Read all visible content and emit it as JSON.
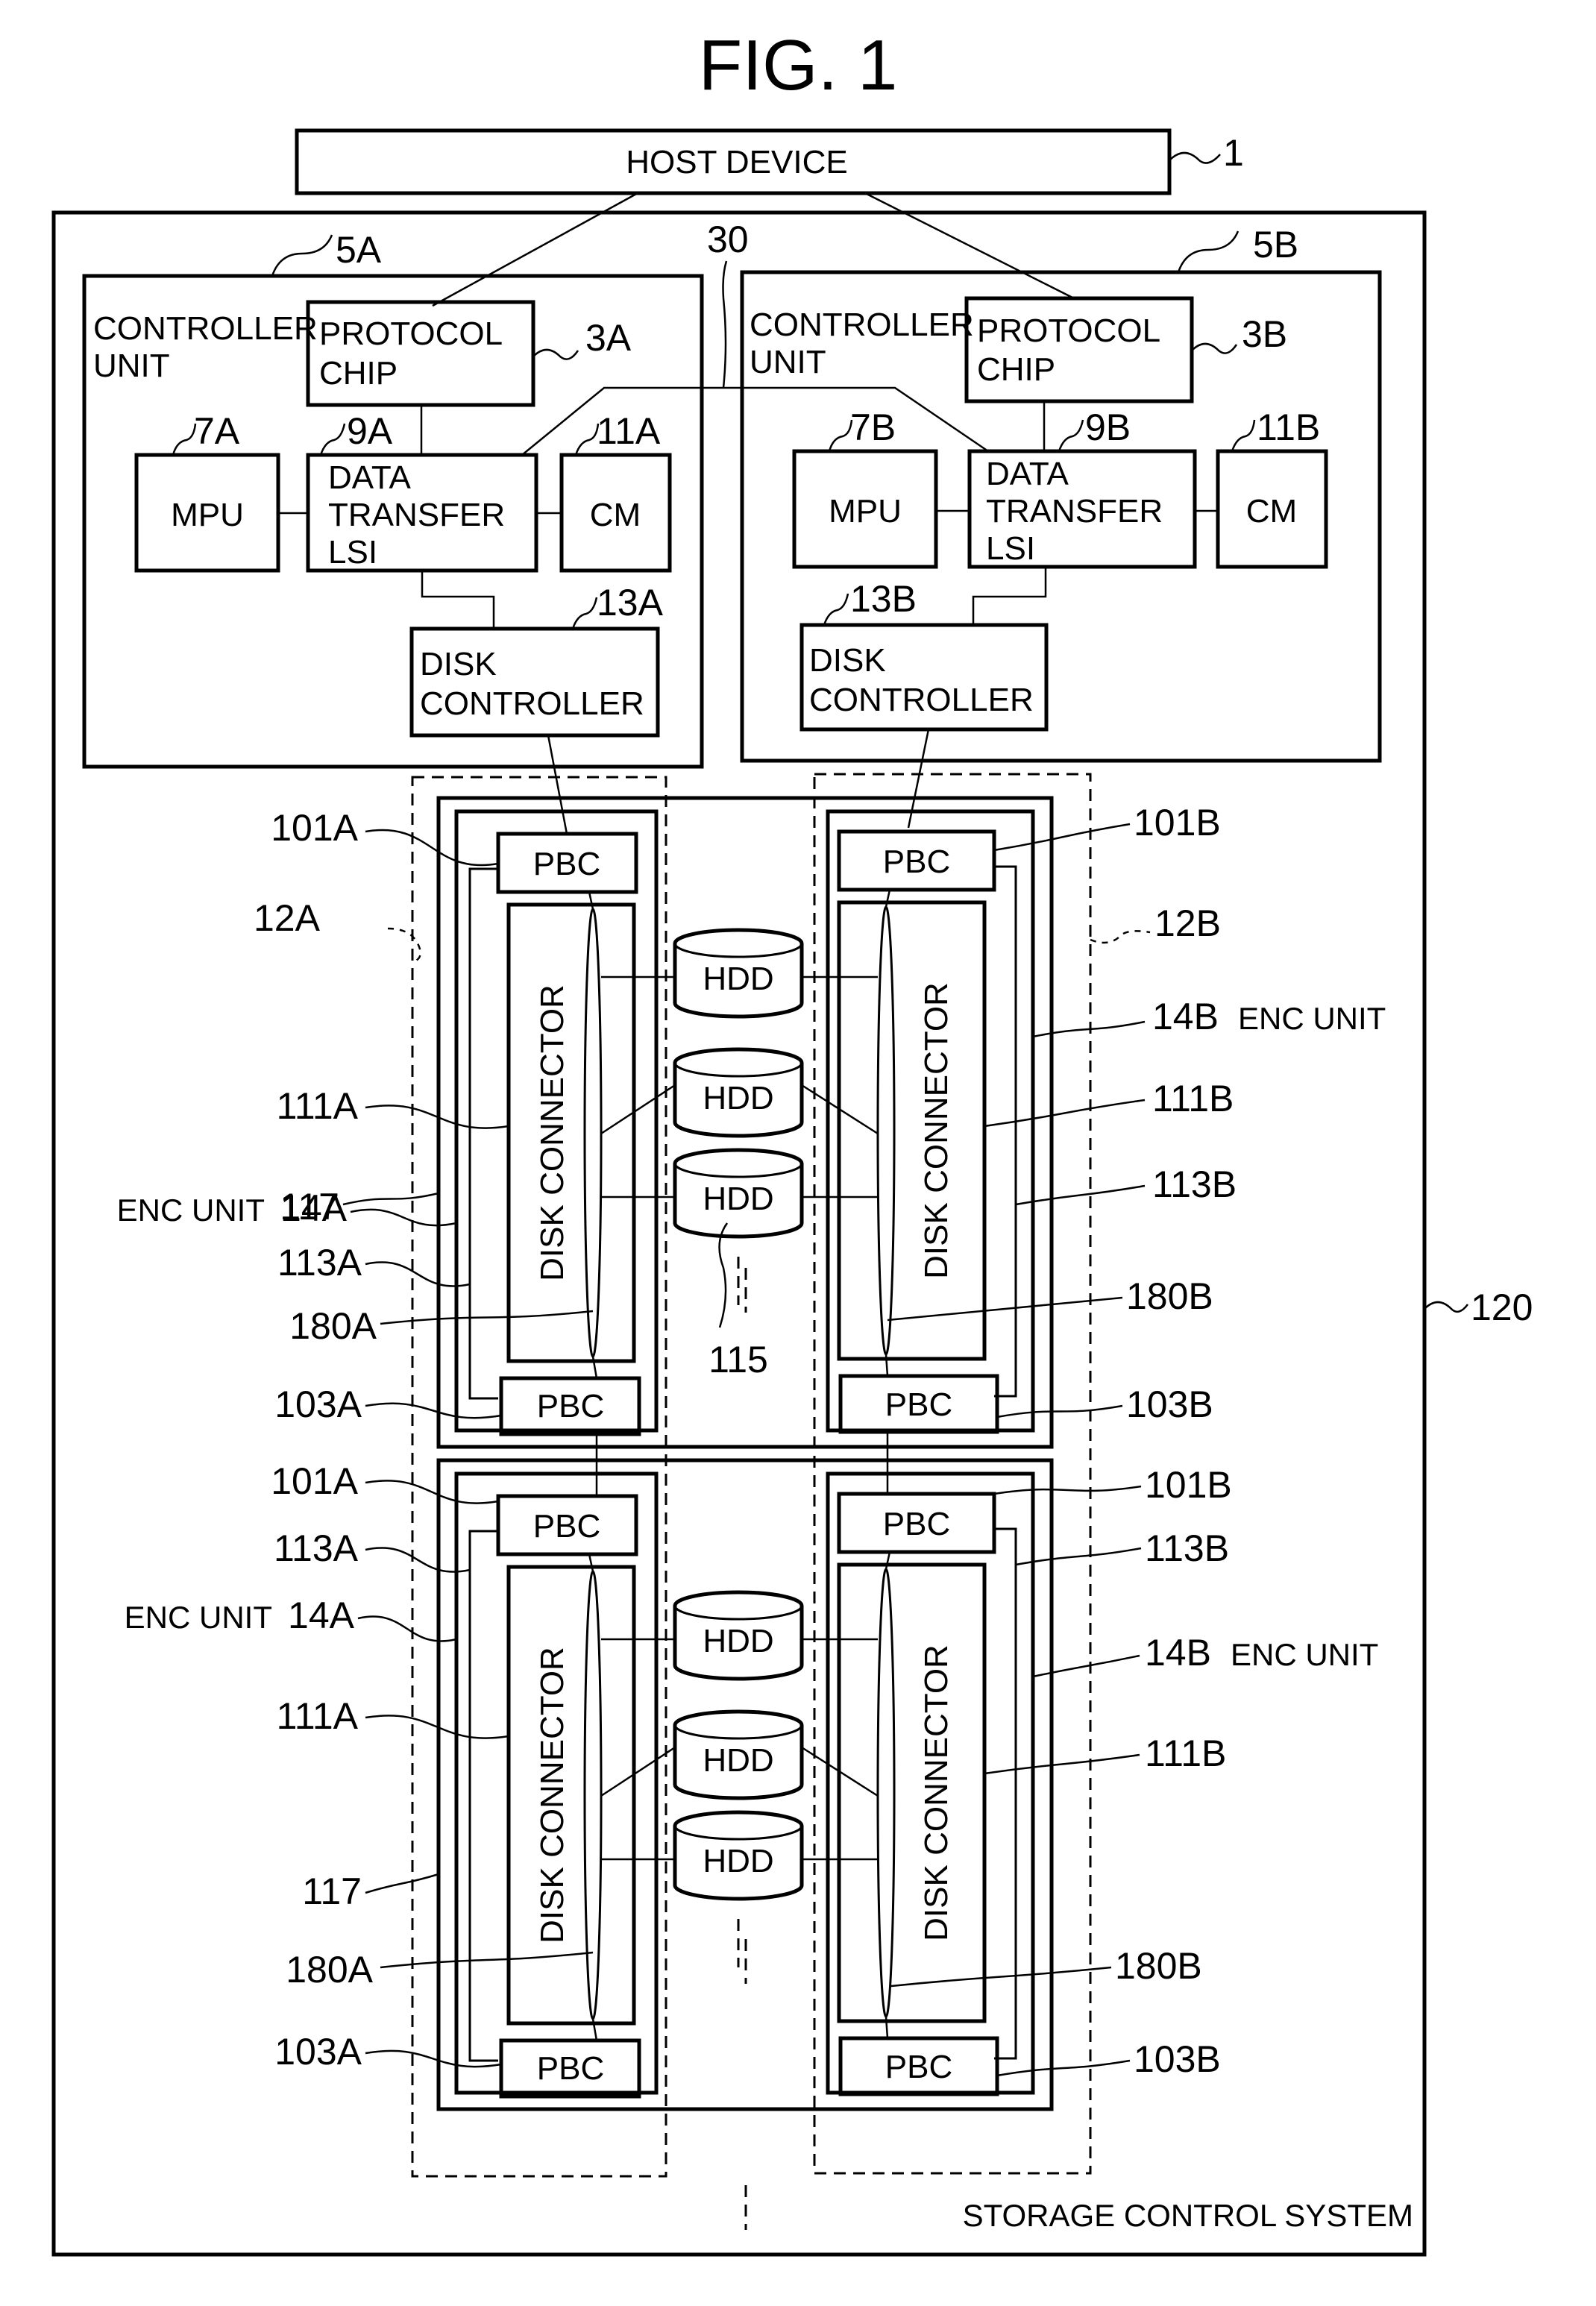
{
  "figure": {
    "title": "FIG. 1",
    "system_label": "STORAGE CONTROL SYSTEM",
    "system_ref": "120",
    "path_ref": "30",
    "host": {
      "label": "HOST DEVICE",
      "ref": "1"
    }
  },
  "controllers": [
    {
      "id": "A",
      "ref": "5A",
      "unit_label_line1": "CONTROLLER",
      "unit_label_line2": "UNIT",
      "protocol_chip": {
        "line1": "PROTOCOL",
        "line2": "CHIP",
        "ref": "3A"
      },
      "mpu": {
        "label": "MPU",
        "ref": "7A"
      },
      "data_transfer_lsi": {
        "line1": "DATA",
        "line2": "TRANSFER",
        "line3": "LSI",
        "ref": "9A"
      },
      "cm": {
        "label": "CM",
        "ref": "11A"
      },
      "disk_controller": {
        "line1": "DISK",
        "line2": "CONTROLLER",
        "ref": "13A"
      }
    },
    {
      "id": "B",
      "ref": "5B",
      "unit_label_line1": "CONTROLLER",
      "unit_label_line2": "UNIT",
      "protocol_chip": {
        "line1": "PROTOCOL",
        "line2": "CHIP",
        "ref": "3B"
      },
      "mpu": {
        "label": "MPU",
        "ref": "7B"
      },
      "data_transfer_lsi": {
        "line1": "DATA",
        "line2": "TRANSFER",
        "line3": "LSI",
        "ref": "9B"
      },
      "cm": {
        "label": "CM",
        "ref": "11B"
      },
      "disk_controller": {
        "line1": "DISK",
        "line2": "CONTROLLER",
        "ref": "13B"
      }
    }
  ],
  "paths": {
    "left_ref": "12A",
    "right_ref": "12B"
  },
  "enclosures": [
    {
      "position": "upper",
      "chassis_ref": "117",
      "hdd_ref": "115",
      "hdds": [
        "HDD",
        "HDD",
        "HDD"
      ],
      "left": {
        "enc_unit_label": "ENC UNIT",
        "enc_unit_ref": "14A",
        "pbc_top": {
          "label": "PBC",
          "ref": "101A"
        },
        "pbc_bottom": {
          "label": "PBC",
          "ref": "103A"
        },
        "disk_connector": {
          "label": "DISK CONNECTOR",
          "ref": "111A"
        },
        "bypass_ref": "113A",
        "loop_ref": "180A"
      },
      "right": {
        "enc_unit_label": "ENC UNIT",
        "enc_unit_ref": "14B",
        "pbc_top": {
          "label": "PBC",
          "ref": "101B"
        },
        "pbc_bottom": {
          "label": "PBC",
          "ref": "103B"
        },
        "disk_connector": {
          "label": "DISK CONNECTOR",
          "ref": "111B"
        },
        "bypass_ref": "113B",
        "loop_ref": "180B"
      }
    },
    {
      "position": "lower",
      "chassis_ref": "117",
      "hdds": [
        "HDD",
        "HDD",
        "HDD"
      ],
      "left": {
        "enc_unit_label": "ENC UNIT",
        "enc_unit_ref": "14A",
        "pbc_top": {
          "label": "PBC",
          "ref": "101A"
        },
        "pbc_bottom": {
          "label": "PBC",
          "ref": "103A"
        },
        "disk_connector": {
          "label": "DISK CONNECTOR",
          "ref": "111A"
        },
        "bypass_ref": "113A",
        "loop_ref": "180A"
      },
      "right": {
        "enc_unit_label": "ENC UNIT",
        "enc_unit_ref": "14B",
        "pbc_top": {
          "label": "PBC",
          "ref": "101B"
        },
        "pbc_bottom": {
          "label": "PBC",
          "ref": "103B"
        },
        "disk_connector": {
          "label": "DISK CONNECTOR",
          "ref": "111B"
        },
        "bypass_ref": "113B",
        "loop_ref": "180B"
      }
    }
  ]
}
